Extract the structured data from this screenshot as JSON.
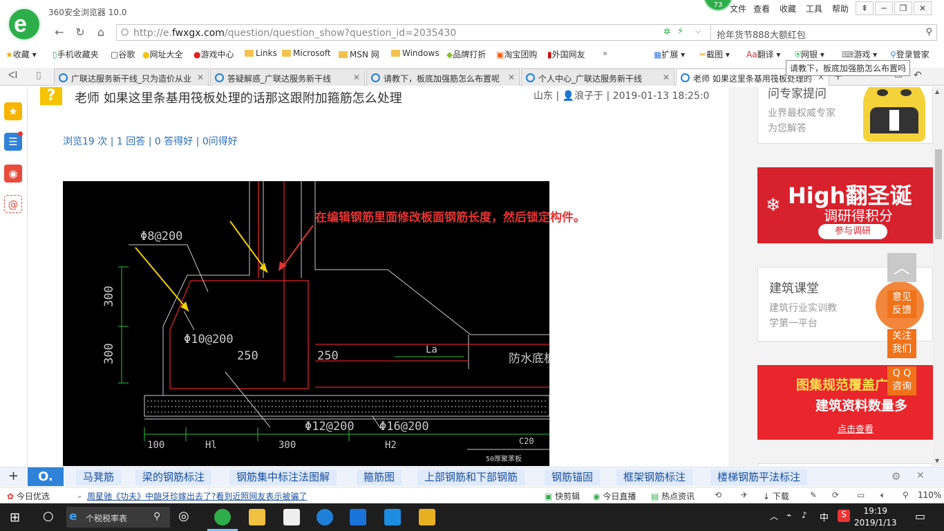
{
  "browser": {
    "title": "360安全浏览器 10.0",
    "badge": "73",
    "menus": [
      "文件",
      "查看",
      "收藏",
      "工具",
      "帮助"
    ]
  },
  "address": {
    "url_prefix": "http://e.",
    "url_domain": "fwxgx.com",
    "url_path": "/question/question_show?question_id=2035430",
    "search_text": "抢年货节888大额红包"
  },
  "bookmarks": [
    "收藏",
    "手机收藏夹",
    "谷歌",
    "网址大全",
    "游戏中心",
    "Links",
    "Microsoft",
    "MSN 网",
    "Windows",
    "品牌打折",
    "淘宝团购",
    "外国网友"
  ],
  "bookmark_tools": [
    "扩展",
    "截图",
    "翻译",
    "网银",
    "游戏",
    "登录管家"
  ],
  "tabs": [
    "广联达服务新干线_只为造价从业",
    "答疑解惑_广联达服务新干线",
    "请教下，板底加强筋怎么布置呢",
    "个人中心_广联达服务新干线",
    "老师 如果这里条基用筏板处理的"
  ],
  "tooltip": "请教下，板底加强筋怎么布置吗",
  "question": {
    "icon": "?",
    "title": "老师 如果这里条基用筏板处理的话那这跟附加箍筋怎么处理",
    "location": "山东",
    "user": "浪子于",
    "time": "2019-01-13 18:25:0",
    "stats": {
      "views": "浏览19 次",
      "answers": "1 回答",
      "good": "0 答得好",
      "useful": "0问得好"
    }
  },
  "cad": {
    "annotation": "在编辑钢筋里面修改板面钢筋长度，然后锁定构件。",
    "labels": [
      "Φ8@200",
      "Φ10@200",
      "250",
      "250",
      "300",
      "300",
      "La",
      "防水底板",
      "Φ12@200",
      "Φ16@200",
      "100",
      "Hl",
      "300",
      "H2",
      "C20",
      "50厚聚苯板"
    ]
  },
  "right": {
    "expert": {
      "title": "问专家提问",
      "line1": "业界最权威专家",
      "line2": "为您解答"
    },
    "banner1": {
      "title": "High翻圣诞",
      "sub": "调研得积分",
      "btn": "参与调研"
    },
    "course": {
      "title": "建筑课堂",
      "line1": "建筑行业实训教",
      "line2": "学第一平台"
    },
    "banner2": {
      "title": "图集规范覆盖广",
      "sub": "建筑资料数量多",
      "btn": "点击查看"
    }
  },
  "floats": {
    "feedback": "意见\n反馈",
    "follow": "关注\n我们",
    "qq": "Q Q\n咨询"
  },
  "keywords": [
    "马凳筋",
    "梁的钢筋标注",
    "钢筋集中标注法图解",
    "箍筋图",
    "上部钢筋和下部钢筋",
    "钢筋锚固",
    "框架钢筋标注",
    "楼梯钢筋平法标注"
  ],
  "status": {
    "today": "今日优选",
    "news": "周星驰《功夫》中龅牙珍嫁出去了?看到近照网友表示被骗了",
    "clip": "快剪辑",
    "live": "今日直播",
    "hot": "热点资讯",
    "download": "下载",
    "zoom": "110%"
  },
  "taskbar": {
    "search": "个税税率表",
    "ime": "中",
    "time": "19:19",
    "date": "2019/1/13"
  },
  "colors": {
    "brand_green": "#2eae4b",
    "link_blue": "#2a6bb8",
    "float_orange": "#f07219",
    "cad_red": "#e53333"
  }
}
